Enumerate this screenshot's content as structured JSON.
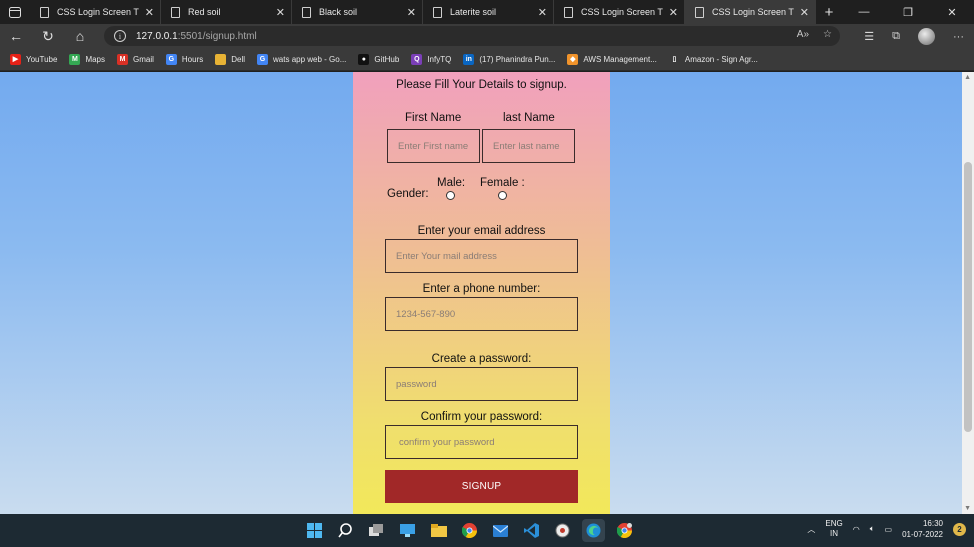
{
  "browser": {
    "tabs": [
      {
        "label": "CSS Login Screen Tuto",
        "active": false
      },
      {
        "label": "Red soil",
        "active": false
      },
      {
        "label": "Black soil",
        "active": false
      },
      {
        "label": "Laterite soil",
        "active": false
      },
      {
        "label": "CSS Login Screen Tuto",
        "active": false
      },
      {
        "label": "CSS Login Screen Tuto",
        "active": true
      }
    ],
    "url_host": "127.0.0.1",
    "url_path": ":5501/signup.html",
    "bookmarks": [
      {
        "label": "YouTube",
        "icon": "youtube-icon",
        "color": "#e62117",
        "glyph": "▶"
      },
      {
        "label": "Maps",
        "icon": "maps-icon",
        "color": "#34a853",
        "glyph": "M"
      },
      {
        "label": "Gmail",
        "icon": "gmail-icon",
        "color": "#d93025",
        "glyph": "M"
      },
      {
        "label": "Hours",
        "icon": "google-icon",
        "color": "#4285f4",
        "glyph": "G"
      },
      {
        "label": "Dell",
        "icon": "folder-icon",
        "color": "#e8b335",
        "glyph": ""
      },
      {
        "label": "wats app web - Go...",
        "icon": "google-icon",
        "color": "#4285f4",
        "glyph": "G"
      },
      {
        "label": "GitHub",
        "icon": "github-icon",
        "color": "#111111",
        "glyph": "●"
      },
      {
        "label": "InfyTQ",
        "icon": "infytq-icon",
        "color": "#7b3fb8",
        "glyph": "Q"
      },
      {
        "label": "(17) Phanindra Pun...",
        "icon": "linkedin-icon",
        "color": "#0a66c2",
        "glyph": "in"
      },
      {
        "label": "AWS Management...",
        "icon": "aws-icon",
        "color": "#f0932b",
        "glyph": "◆"
      },
      {
        "label": "Amazon - Sign Agr...",
        "icon": "page-icon",
        "color": "#3a3a3a",
        "glyph": "▯"
      }
    ]
  },
  "form": {
    "heading": "Please Fill Your Details to signup.",
    "first_name_label": "First Name",
    "last_name_label": "last Name",
    "first_name_placeholder": "Enter First name",
    "last_name_placeholder": "Enter last name",
    "gender_label": "Gender:",
    "male_label": "Male:",
    "female_label": "Female :",
    "email_label": "Enter your email address",
    "email_placeholder": "Enter Your mail address",
    "phone_label": "Enter a phone number:",
    "phone_placeholder": "1234-567-890",
    "password_label": "Create a password:",
    "password_placeholder": "password",
    "confirm_label": "Confirm your password:",
    "confirm_placeholder": "confirm your password",
    "submit_label": "SIGNUP"
  },
  "colors": {
    "button": "#a12828",
    "card_top": "#f1a0bd",
    "card_bottom": "#f2e85a",
    "page_bg": "#73aaef"
  },
  "taskbar": {
    "lang_line1": "ENG",
    "lang_line2": "IN",
    "time": "16:30",
    "date": "01-07-2022",
    "notifications": "2"
  }
}
